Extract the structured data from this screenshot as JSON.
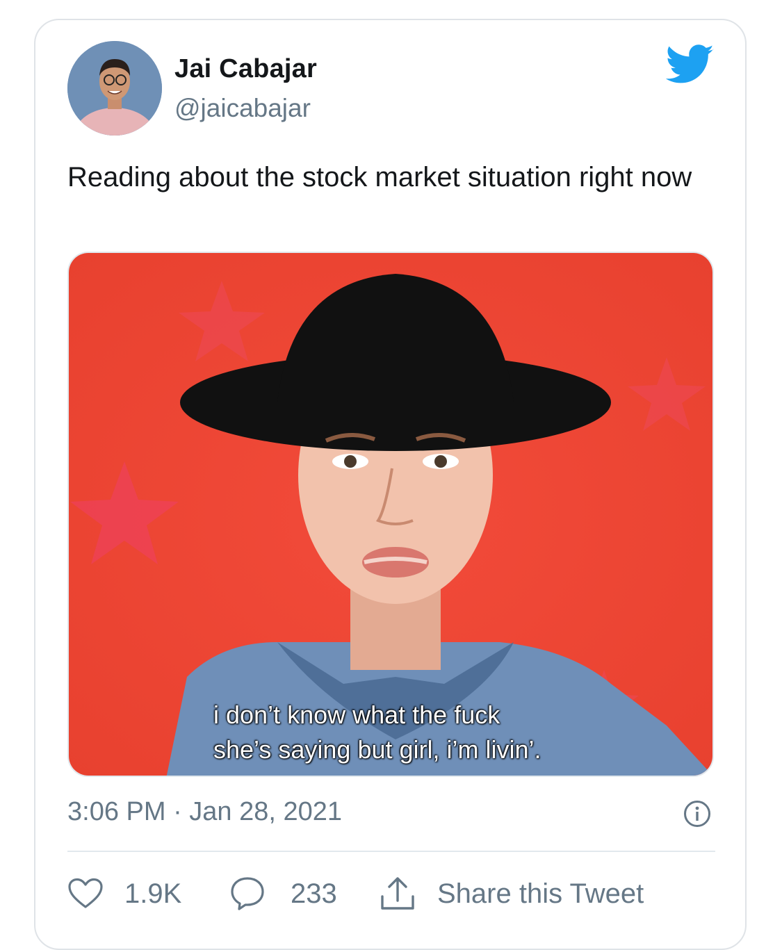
{
  "user": {
    "name": "Jai Cabajar",
    "handle": "@jaicabajar"
  },
  "tweet": {
    "text": "Reading about the stock market situation right now",
    "media_caption": "i don’t know what the fuck\nshe’s saying but girl, i’m livin’.",
    "timestamp": "3:06 PM · Jan 28, 2021"
  },
  "actions": {
    "likes": "1.9K",
    "replies": "233",
    "share_label": "Share this Tweet"
  },
  "icons": {
    "brand": "twitter-bird-icon",
    "like": "heart-icon",
    "reply": "speech-bubble-icon",
    "share": "share-upload-icon",
    "info": "info-icon"
  },
  "colors": {
    "brand_blue": "#1DA1F2",
    "text": "#14171A",
    "secondary": "#657786",
    "media_background": "#E8412F"
  }
}
